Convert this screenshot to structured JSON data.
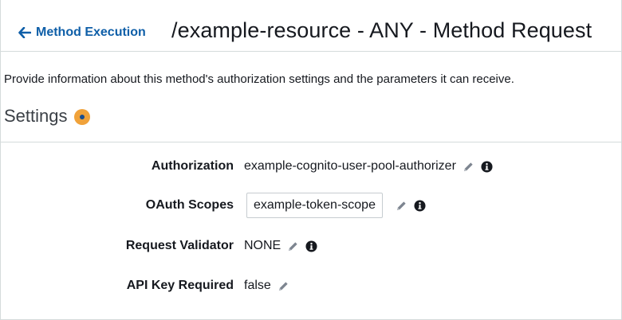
{
  "header": {
    "back_label": "Method Execution",
    "title": "/example-resource - ANY - Method Request"
  },
  "description": "Provide information about this method's authorization settings and the parameters it can receive.",
  "settings": {
    "title": "Settings"
  },
  "fields": {
    "authorization": {
      "label": "Authorization",
      "value": "example-cognito-user-pool-authorizer"
    },
    "oauth_scopes": {
      "label": "OAuth Scopes",
      "value": "example-token-scope"
    },
    "request_validator": {
      "label": "Request Validator",
      "value": "NONE"
    },
    "api_key_required": {
      "label": "API Key Required",
      "value": "false"
    }
  },
  "icons": {
    "back": "arrow-left-icon",
    "edit": "pencil-icon",
    "info": "info-circle-icon"
  },
  "colors": {
    "link": "#0f5fa8",
    "info_badge": "#f0a23a",
    "text": "#16191f",
    "border": "#d5dbdb"
  }
}
